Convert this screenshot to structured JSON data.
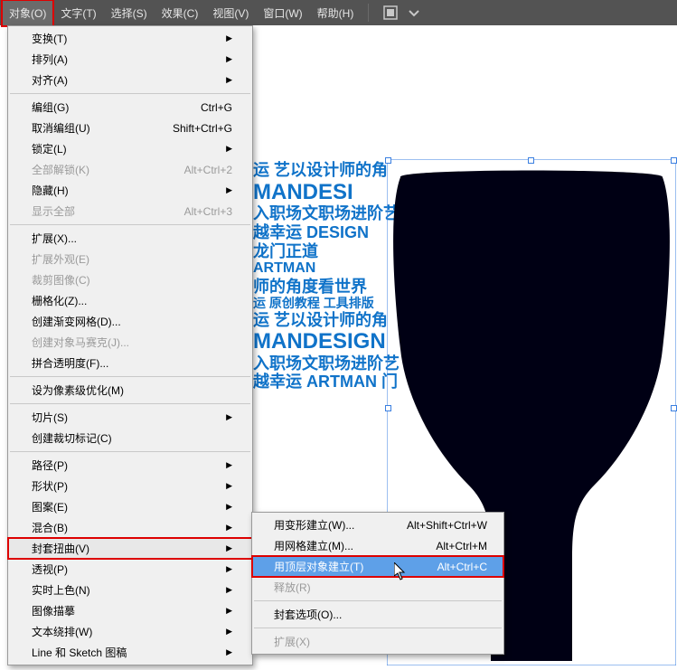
{
  "menubar": {
    "items": [
      {
        "label": "对象(O)"
      },
      {
        "label": "文字(T)"
      },
      {
        "label": "选择(S)"
      },
      {
        "label": "效果(C)"
      },
      {
        "label": "视图(V)"
      },
      {
        "label": "窗口(W)"
      },
      {
        "label": "帮助(H)"
      }
    ]
  },
  "dropdown": {
    "groups": [
      [
        {
          "label": "变换(T)",
          "submenu": true
        },
        {
          "label": "排列(A)",
          "submenu": true
        },
        {
          "label": "对齐(A)",
          "submenu": true
        }
      ],
      [
        {
          "label": "编组(G)",
          "shortcut": "Ctrl+G"
        },
        {
          "label": "取消编组(U)",
          "shortcut": "Shift+Ctrl+G"
        },
        {
          "label": "锁定(L)",
          "submenu": true
        },
        {
          "label": "全部解锁(K)",
          "shortcut": "Alt+Ctrl+2",
          "disabled": true
        },
        {
          "label": "隐藏(H)",
          "submenu": true
        },
        {
          "label": "显示全部",
          "shortcut": "Alt+Ctrl+3",
          "disabled": true
        }
      ],
      [
        {
          "label": "扩展(X)..."
        },
        {
          "label": "扩展外观(E)",
          "disabled": true
        },
        {
          "label": "裁剪图像(C)",
          "disabled": true
        },
        {
          "label": "栅格化(Z)..."
        },
        {
          "label": "创建渐变网格(D)..."
        },
        {
          "label": "创建对象马赛克(J)...",
          "disabled": true
        },
        {
          "label": "拼合透明度(F)..."
        }
      ],
      [
        {
          "label": "设为像素级优化(M)"
        }
      ],
      [
        {
          "label": "切片(S)",
          "submenu": true
        },
        {
          "label": "创建裁切标记(C)"
        }
      ],
      [
        {
          "label": "路径(P)",
          "submenu": true
        },
        {
          "label": "形状(P)",
          "submenu": true
        },
        {
          "label": "图案(E)",
          "submenu": true
        },
        {
          "label": "混合(B)",
          "submenu": true
        },
        {
          "label": "封套扭曲(V)",
          "submenu": true,
          "highlight": true
        },
        {
          "label": "透视(P)",
          "submenu": true
        },
        {
          "label": "实时上色(N)",
          "submenu": true
        },
        {
          "label": "图像描摹",
          "submenu": true
        },
        {
          "label": "文本绕排(W)",
          "submenu": true
        },
        {
          "label": "Line 和 Sketch 图稿",
          "submenu": true
        }
      ]
    ]
  },
  "submenu": {
    "items": [
      {
        "label": "用变形建立(W)...",
        "shortcut": "Alt+Shift+Ctrl+W"
      },
      {
        "label": "用网格建立(M)...",
        "shortcut": "Alt+Ctrl+M"
      },
      {
        "label": "用顶层对象建立(T)",
        "shortcut": "Alt+Ctrl+C",
        "highlight": true
      },
      {
        "label": "释放(R)",
        "disabled": true
      }
    ],
    "items2": [
      {
        "label": "封套选项(O)..."
      }
    ],
    "items3": [
      {
        "label": "扩展(X)",
        "disabled": true
      }
    ]
  },
  "art_lines": [
    "运 艺以设计师的角",
    "MANDESI",
    "入职场文职场进阶艺",
    "越幸运 DESIGN",
    "龙门正道",
    "ARTMAN",
    "师的角度看世界",
    "运 原创教程 工具排版",
    "运 艺以设计师的角",
    "MANDESIGN",
    "入职场文职场进阶艺 庞",
    "越幸运 ARTMAN 门"
  ]
}
